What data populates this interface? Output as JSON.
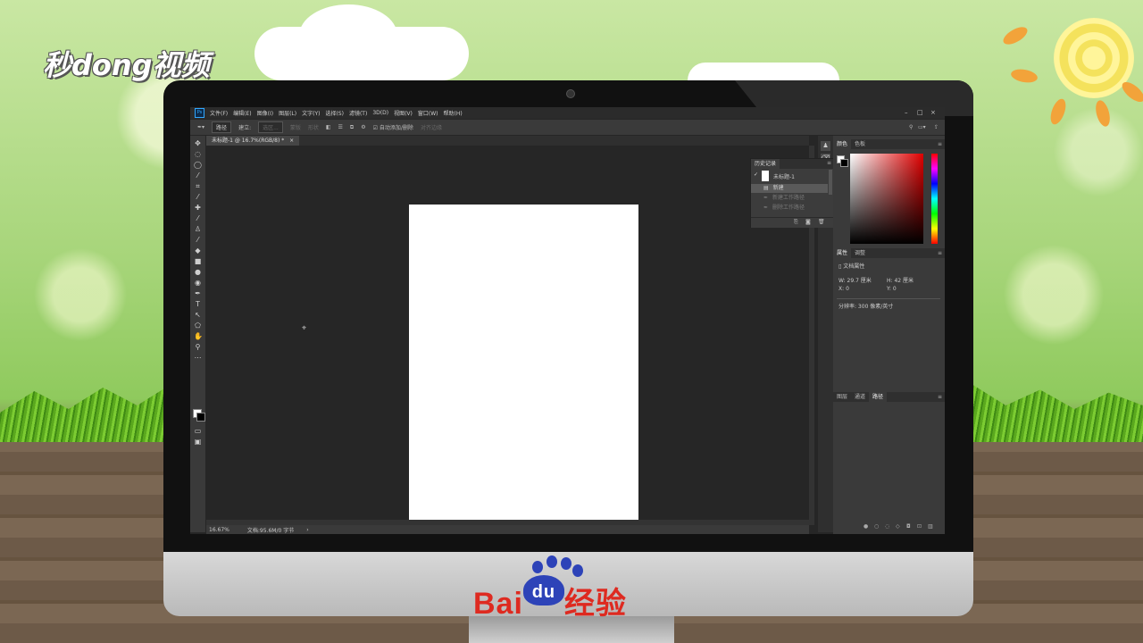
{
  "watermark": {
    "channel_logo": "秒dong视频",
    "baidu_brand": "Bai",
    "baidu_paw": "du",
    "baidu_suffix": "经验"
  },
  "app": {
    "logo": "Ps",
    "menu": [
      "文件(F)",
      "编辑(E)",
      "图像(I)",
      "图层(L)",
      "文字(Y)",
      "选择(S)",
      "滤镜(T)",
      "3D(D)",
      "视图(V)",
      "窗口(W)",
      "帮助(H)"
    ],
    "window_controls": {
      "minimize": "–",
      "maximize": "□",
      "close": "×"
    }
  },
  "options": {
    "shape_mode": "路径",
    "make_label": "建立:",
    "selection_btn": "选区...",
    "mask_btn": "蒙版",
    "shape_btn": "形状",
    "auto_add_delete": "自动添加/删除",
    "align_edges": "对齐边缘"
  },
  "document": {
    "tab_title": "未标题-1 @ 16.7%(RGB/8) *",
    "tab_close": "×",
    "zoom": "16.67%",
    "doc_info": "文档:95.6M/0 字节"
  },
  "color_panel": {
    "tabs": [
      "颜色",
      "色板"
    ]
  },
  "history_panel": {
    "title": "历史记录",
    "snapshot": "未标题-1",
    "items": [
      "新建",
      "新建工作路径",
      "删除工作路径"
    ]
  },
  "properties_panel": {
    "tabs": [
      "属性",
      "调整"
    ],
    "section": "文档属性",
    "w_label": "W:",
    "w_value": "29.7 厘米",
    "h_label": "H:",
    "h_value": "42 厘米",
    "x_label": "X:",
    "x_value": "0",
    "y_label": "Y:",
    "y_value": "0",
    "resolution": "分辨率: 300 像素/英寸"
  },
  "layers_panel": {
    "tabs": [
      "图层",
      "通道",
      "路径"
    ]
  }
}
